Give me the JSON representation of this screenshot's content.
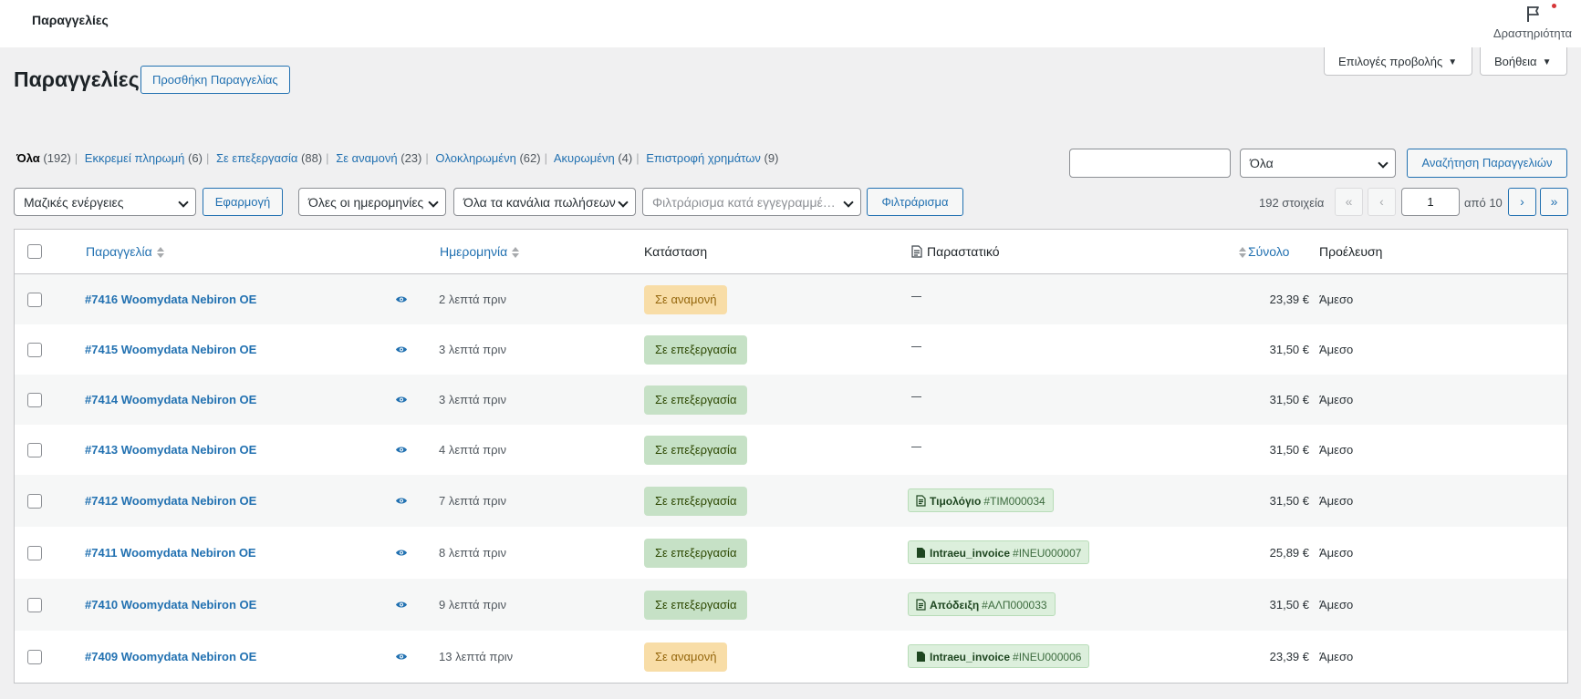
{
  "topbar": {
    "title": "Παραγγελίες",
    "activity_label": "Δραστηριότητα"
  },
  "screen_options": {
    "options_label": "Επιλογές προβολής",
    "help_label": "Βοήθεια"
  },
  "heading": {
    "title": "Παραγγελίες",
    "add_button": "Προσθήκη Παραγγελίας"
  },
  "status_filters": [
    {
      "label": "Όλα",
      "count": "(192)"
    },
    {
      "label": "Εκκρεμεί πληρωμή",
      "count": "(6)"
    },
    {
      "label": "Σε επεξεργασία",
      "count": "(88)"
    },
    {
      "label": "Σε αναμονή",
      "count": "(23)"
    },
    {
      "label": "Ολοκληρωμένη",
      "count": "(62)"
    },
    {
      "label": "Ακυρωμένη",
      "count": "(4)"
    },
    {
      "label": "Επιστροφή χρημάτων",
      "count": "(9)"
    }
  ],
  "search": {
    "value": "",
    "scope": "Όλα",
    "button": "Αναζήτηση Παραγγελιών"
  },
  "filters": {
    "bulk_actions": "Μαζικές ενέργειες",
    "apply": "Εφαρμογή",
    "dates": "Όλες οι ημερομηνίες",
    "channels": "Όλα τα κανάλια πωλήσεων",
    "customer_placeholder": "Φιλτράρισμα κατά εγγεγραμμένο πελάτη",
    "filter_button": "Φιλτράρισμα"
  },
  "pagination": {
    "items": "192 στοιχεία",
    "first": "«",
    "prev": "‹",
    "current_page": "1",
    "of_pages": "από 10",
    "next": "›",
    "last": "»"
  },
  "columns": {
    "order": "Παραγγελία",
    "date": "Ημερομηνία",
    "status": "Κατάσταση",
    "document": "Παραστατικό",
    "total": "Σύνολο",
    "origin": "Προέλευση"
  },
  "orders": [
    {
      "order": "#7416 Woomydata Nebiron OE",
      "date": "2 λεπτά πριν",
      "status": "Σε αναμονή",
      "status_type": "hold",
      "doc_name": "",
      "doc_code": "",
      "doc_icon": "",
      "total": "23,39 €",
      "origin": "Άμεσο"
    },
    {
      "order": "#7415 Woomydata Nebiron OE",
      "date": "3 λεπτά πριν",
      "status": "Σε επεξεργασία",
      "status_type": "proc",
      "doc_name": "",
      "doc_code": "",
      "doc_icon": "",
      "total": "31,50 €",
      "origin": "Άμεσο"
    },
    {
      "order": "#7414 Woomydata Nebiron OE",
      "date": "3 λεπτά πριν",
      "status": "Σε επεξεργασία",
      "status_type": "proc",
      "doc_name": "",
      "doc_code": "",
      "doc_icon": "",
      "total": "31,50 €",
      "origin": "Άμεσο"
    },
    {
      "order": "#7413 Woomydata Nebiron OE",
      "date": "4 λεπτά πριν",
      "status": "Σε επεξεργασία",
      "status_type": "proc",
      "doc_name": "",
      "doc_code": "",
      "doc_icon": "",
      "total": "31,50 €",
      "origin": "Άμεσο"
    },
    {
      "order": "#7412 Woomydata Nebiron OE",
      "date": "7 λεπτά πριν",
      "status": "Σε επεξεργασία",
      "status_type": "proc",
      "doc_name": "Τιμολόγιο",
      "doc_code": "#ΤΙΜ000034",
      "doc_icon": "document-lines-icon",
      "total": "31,50 €",
      "origin": "Άμεσο"
    },
    {
      "order": "#7411 Woomydata Nebiron OE",
      "date": "8 λεπτά πριν",
      "status": "Σε επεξεργασία",
      "status_type": "proc",
      "doc_name": "Intraeu_invoice",
      "doc_code": "#INEU000007",
      "doc_icon": "document-solid-icon",
      "total": "25,89 €",
      "origin": "Άμεσο"
    },
    {
      "order": "#7410 Woomydata Nebiron OE",
      "date": "9 λεπτά πριν",
      "status": "Σε επεξεργασία",
      "status_type": "proc",
      "doc_name": "Απόδειξη",
      "doc_code": "#ΑΛΠ000033",
      "doc_icon": "document-lines-icon",
      "total": "31,50 €",
      "origin": "Άμεσο"
    },
    {
      "order": "#7409 Woomydata Nebiron OE",
      "date": "13 λεπτά πριν",
      "status": "Σε αναμονή",
      "status_type": "hold",
      "doc_name": "Intraeu_invoice",
      "doc_code": "#INEU000006",
      "doc_icon": "document-solid-icon",
      "total": "23,39 €",
      "origin": "Άμεσο"
    }
  ],
  "colors": {
    "accent": "#2271b1",
    "hold_bg": "#f8dda7",
    "hold_fg": "#94660c",
    "proc_bg": "#c6e1c6",
    "proc_fg": "#2c4700",
    "doc_bg": "#dcefdc"
  }
}
